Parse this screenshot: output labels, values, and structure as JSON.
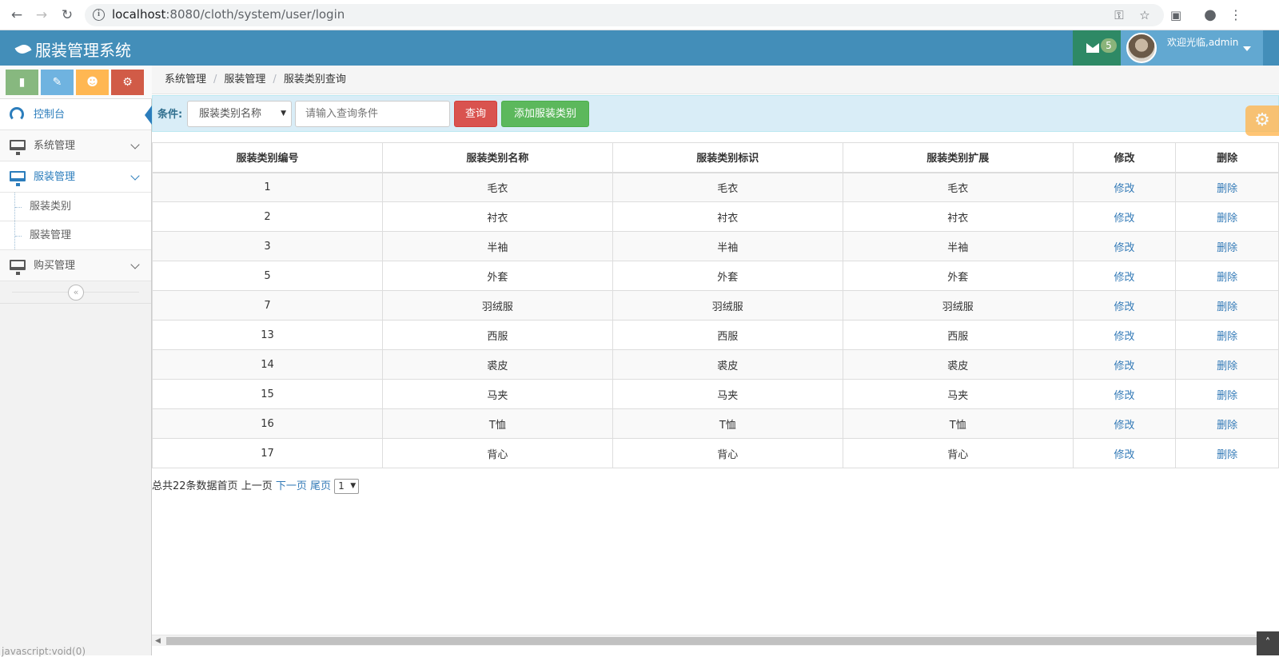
{
  "browser": {
    "url_host": "localhost",
    "url_rest": ":8080/cloth/system/user/login",
    "back_icon": "arrow-left-icon",
    "forward_icon": "arrow-right-icon",
    "reload_icon": "reload-icon"
  },
  "header": {
    "brand": "服装管理系统",
    "mail_count": "5",
    "welcome": "欢迎光临,admin",
    "colors": {
      "bar": "#438eb9",
      "mail": "#2e8965",
      "user": "#62a8d1"
    }
  },
  "shortcuts": [
    {
      "icon": "signal-icon",
      "color": "#87b87f"
    },
    {
      "icon": "pencil-icon",
      "color": "#6fb3e0"
    },
    {
      "icon": "users-icon",
      "color": "#ffb752"
    },
    {
      "icon": "cogs-icon",
      "color": "#d15b47"
    }
  ],
  "sidebar": {
    "dashboard": "控制台",
    "system": "系统管理",
    "clothing": "服装管理",
    "clothing_sub": [
      "服装类别",
      "服装管理"
    ],
    "purchase": "购买管理"
  },
  "breadcrumb": [
    "系统管理",
    "服装管理",
    "服装类别查询"
  ],
  "search": {
    "label": "条件:",
    "select_value": "服装类别名称",
    "placeholder": "请输入查询条件",
    "query_button": "查询",
    "add_button": "添加服装类别"
  },
  "table": {
    "headers": [
      "服装类别编号",
      "服装类别名称",
      "服装类别标识",
      "服装类别扩展",
      "修改",
      "删除"
    ],
    "edit_label": "修改",
    "delete_label": "删除",
    "rows": [
      [
        "1",
        "毛衣",
        "毛衣",
        "毛衣"
      ],
      [
        "2",
        "衬衣",
        "衬衣",
        "衬衣"
      ],
      [
        "3",
        "半袖",
        "半袖",
        "半袖"
      ],
      [
        "5",
        "外套",
        "外套",
        "外套"
      ],
      [
        "7",
        "羽绒服",
        "羽绒服",
        "羽绒服"
      ],
      [
        "13",
        "西服",
        "西服",
        "西服"
      ],
      [
        "14",
        "裘皮",
        "裘皮",
        "裘皮"
      ],
      [
        "15",
        "马夹",
        "马夹",
        "马夹"
      ],
      [
        "16",
        "T恤",
        "T恤",
        "T恤"
      ],
      [
        "17",
        "背心",
        "背心",
        "背心"
      ]
    ]
  },
  "pager": {
    "summary": "总共22条数据",
    "first": "首页",
    "prev": "上一页",
    "next": "下一页",
    "last": "尾页",
    "page": "1"
  },
  "status_bar": "javascript:void(0)"
}
